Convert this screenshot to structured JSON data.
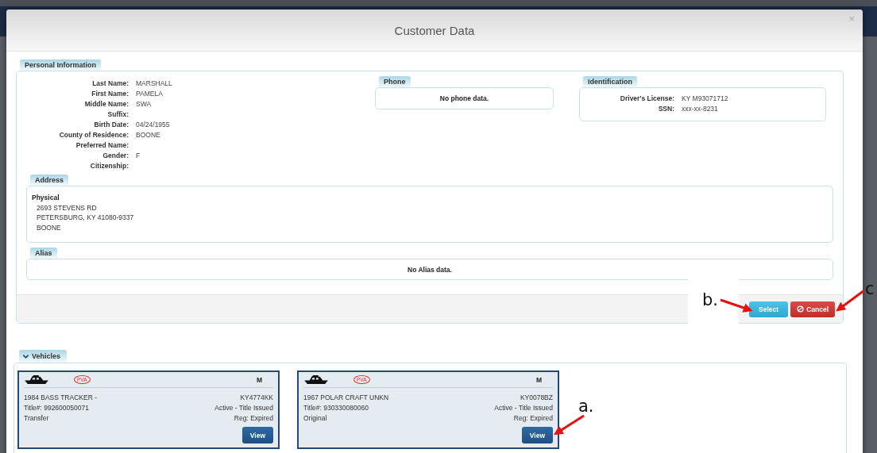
{
  "window": {
    "title": "Customer Data",
    "close": "×"
  },
  "personal": {
    "legend": "Personal Information",
    "fields": [
      {
        "label": "Last Name:",
        "value": "MARSHALL"
      },
      {
        "label": "First Name:",
        "value": "PAMELA"
      },
      {
        "label": "Middle Name:",
        "value": "SWA"
      },
      {
        "label": "Suffix:"
      },
      {
        "label": "Birth Date:",
        "value": "04/24/1955"
      },
      {
        "label": "County of Residence:",
        "value": "BOONE"
      },
      {
        "label": "Preferred Name:"
      },
      {
        "label": "Gender:",
        "value": "F"
      },
      {
        "label": "Citizenship:"
      }
    ],
    "phone": {
      "legend": "Phone",
      "message": "No phone data."
    },
    "identification": {
      "legend": "Identification",
      "fields": [
        {
          "label": "Driver's License:",
          "value": "KY M93071712"
        },
        {
          "label": "SSN:",
          "value": "xxx-xx-8231"
        }
      ]
    },
    "address": {
      "legend": "Address",
      "type": "Physical",
      "lines": [
        "2693 STEVENS RD",
        "PETERSBURG, KY 41080-9337",
        "BOONE"
      ]
    },
    "alias": {
      "legend": "Alias",
      "message": "No Alias data."
    }
  },
  "actions": [
    {
      "label": "Select",
      "kind": "primary"
    },
    {
      "label": "Cancel",
      "kind": "danger"
    }
  ],
  "vehicles": {
    "legend": "Vehicles",
    "expanded": true,
    "cards": [
      {
        "badge": "PVA",
        "class": "M",
        "description": "1984 BASS TRACKER -",
        "plate": "KY4774KK",
        "title": "Title#: 992600050071",
        "status": "Active - Title Issued",
        "transaction": "Transfer",
        "registration": "Reg: Expired",
        "button": "View"
      },
      {
        "badge": "PVA",
        "class": "M",
        "description": "1967 POLAR CRAFT UNKN",
        "plate": "KY0078BZ",
        "title": "Title#: 930330080060",
        "status": "Active - Title Issued",
        "transaction": "Original",
        "registration": "Reg: Expired",
        "button": "View"
      }
    ]
  },
  "annotations": [
    {
      "label": "a."
    },
    {
      "label": "b."
    },
    {
      "label": "c"
    }
  ]
}
